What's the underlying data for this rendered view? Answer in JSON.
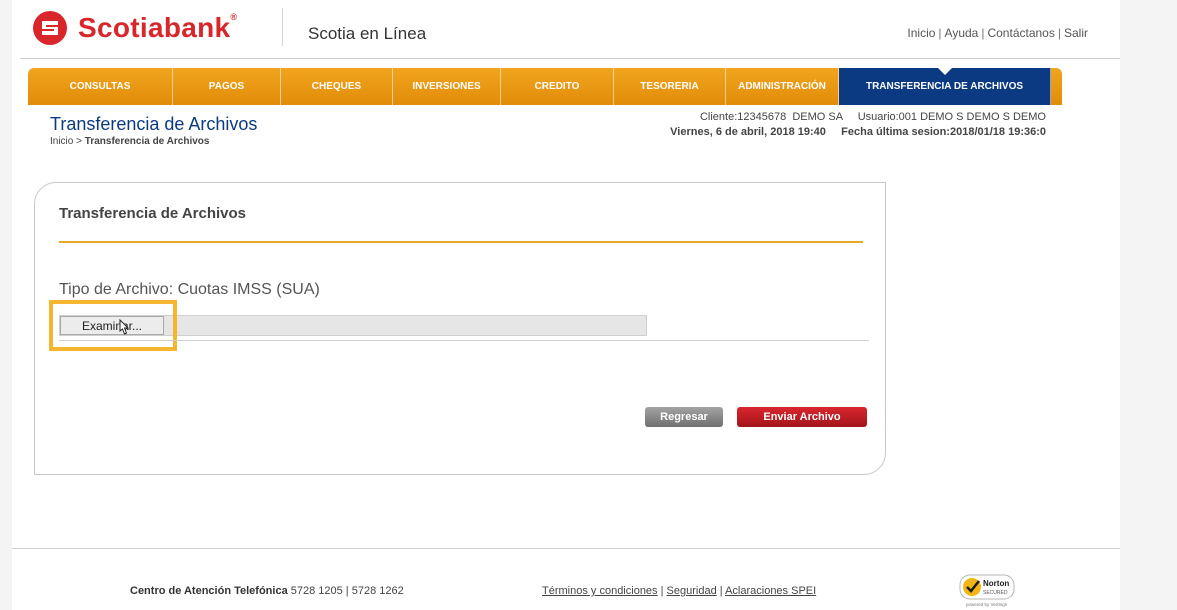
{
  "header": {
    "brand_name": "Scotiabank",
    "brand_mark": "®",
    "site_name": "Scotia en Línea",
    "top_links": [
      "Inicio",
      "Ayuda",
      "Contáctanos",
      "Salir"
    ]
  },
  "nav": {
    "items": [
      {
        "label": "CONSULTAS"
      },
      {
        "label": "PAGOS"
      },
      {
        "label": "CHEQUES"
      },
      {
        "label": "INVERSIONES"
      },
      {
        "label": "CREDITO"
      },
      {
        "label": "TESORERIA"
      },
      {
        "label": "ADMINISTRACIÓN"
      },
      {
        "label": "TRANSFERENCIA DE ARCHIVOS"
      }
    ],
    "active": "TRANSFERENCIA DE ARCHIVOS"
  },
  "page": {
    "title": "Transferencia de Archivos",
    "breadcrumb_home": "Inicio",
    "breadcrumb_sep": " > ",
    "breadcrumb_current": "Transferencia de Archivos",
    "client_line": "Cliente:12345678  DEMO SA     Usuario:001 DEMO S DEMO S DEMO",
    "date_line": "Viernes, 6 de abril, 2018 19:40     Fecha última sesion:2018/01/18 19:36:0"
  },
  "panel": {
    "title": "Transferencia de Archivos",
    "file_type": "Tipo de Archivo: Cuotas IMSS (SUA)",
    "browse_label": "Examinar...",
    "back_label": "Regresar",
    "send_label": "Enviar Archivo"
  },
  "footer": {
    "phone_label": "Centro de Atención Telefónica",
    "phone_numbers": " 5728 1205 | 5728 1262",
    "links": [
      "Términos y condiciones",
      "Seguridad",
      "Aclaraciones SPEI"
    ],
    "norton_label": "Norton",
    "norton_sub": "SECURED",
    "norton_powered": "powered by VeriSign"
  },
  "colors": {
    "brand_red": "#d8262b",
    "nav_orange": "#e9980f",
    "nav_active": "#0b3a82",
    "highlight": "#f6b52e"
  }
}
